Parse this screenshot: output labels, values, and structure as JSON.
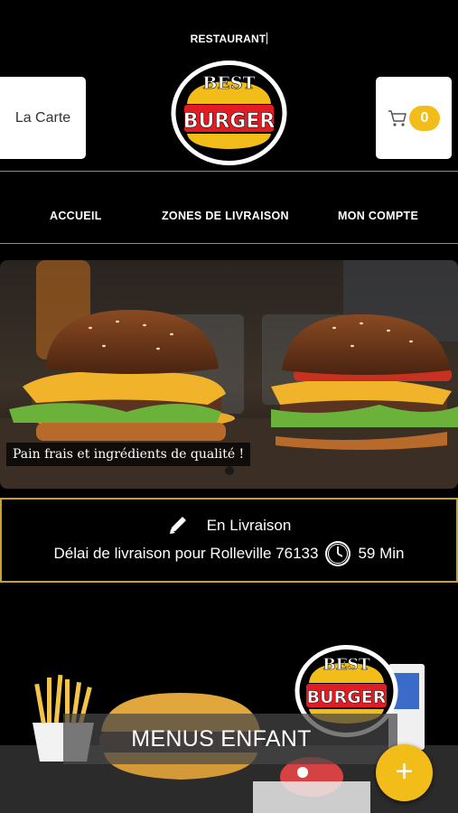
{
  "header": {
    "restaurant_label": "RESTAURANT",
    "card_button_label": "La Carte",
    "cart_count": "0",
    "logo": {
      "line1": "BEST",
      "line2": "BURGER"
    }
  },
  "nav": {
    "items": [
      {
        "label": "ACCUEIL"
      },
      {
        "label": "ZONES DE LIVRAISON"
      },
      {
        "label": "MON COMPTE"
      }
    ]
  },
  "hero": {
    "caption": "Pain frais et ingrédients de qualité !"
  },
  "delivery": {
    "mode": "En Livraison",
    "delay_text": "Délai de livraison pour Rolleville 76133",
    "delay_value": "59 Min"
  },
  "promo": {
    "title": "MENUS ENFANT",
    "logo": {
      "line1": "BEST",
      "line2": "BURGER"
    }
  },
  "fab": {
    "label": "+"
  },
  "colors": {
    "accent": "#f3bd19",
    "border_gold": "#c9a227",
    "logo_red": "#e31b23",
    "background": "#000000"
  },
  "icons": [
    "cart-icon",
    "pencil-icon",
    "clock-icon",
    "plus-icon"
  ]
}
